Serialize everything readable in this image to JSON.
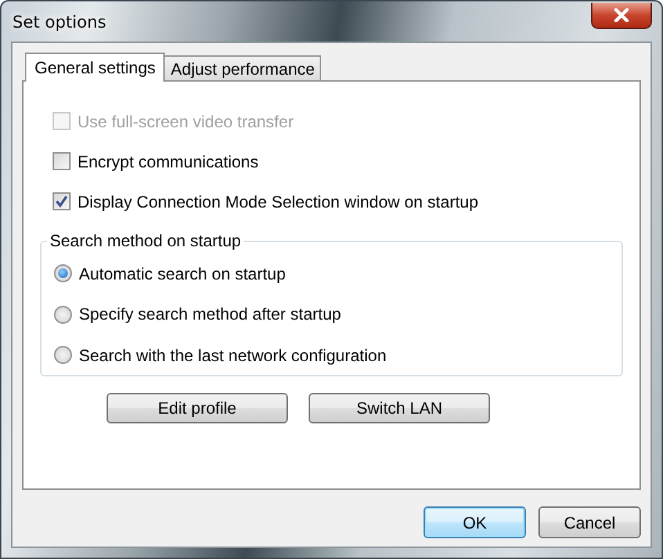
{
  "window": {
    "title": "Set options"
  },
  "tabs": [
    {
      "label": "General settings",
      "selected": true
    },
    {
      "label": "Adjust performance",
      "selected": false
    }
  ],
  "options": [
    {
      "label": "Use full-screen video transfer",
      "checked": false,
      "disabled": true
    },
    {
      "label": "Encrypt communications",
      "checked": false,
      "disabled": false
    },
    {
      "label": "Display Connection Mode Selection window on startup",
      "checked": true,
      "disabled": false
    }
  ],
  "search_group": {
    "title": "Search method on startup",
    "options": [
      {
        "label": "Automatic search on startup",
        "selected": true
      },
      {
        "label": "Specify search method after startup",
        "selected": false
      },
      {
        "label": "Search with the last network configuration",
        "selected": false
      }
    ]
  },
  "action_buttons": [
    "Edit profile",
    "Switch LAN"
  ],
  "dialog_buttons": [
    {
      "label": "OK",
      "default": true
    },
    {
      "label": "Cancel",
      "default": false
    }
  ]
}
